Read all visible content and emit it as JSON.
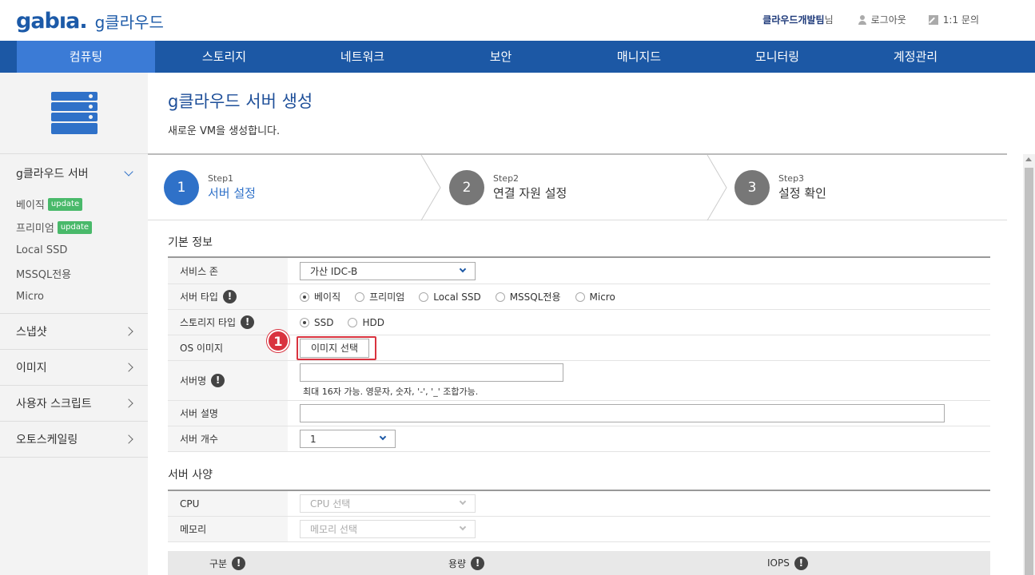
{
  "header": {
    "logo_text": "gabıa.",
    "product_name": "g클라우드",
    "user_name": "클라우드개발팀",
    "user_suffix": "님",
    "logout_label": "로그아웃",
    "inquiry_label": "1:1 문의"
  },
  "nav": {
    "items": [
      "컴퓨팅",
      "스토리지",
      "네트워크",
      "보안",
      "매니지드",
      "모니터링",
      "계정관리"
    ],
    "active_index": 0
  },
  "sidebar": {
    "server_group": {
      "label": "g클라우드 서버",
      "items": [
        {
          "label": "베이직",
          "badge": "update"
        },
        {
          "label": "프리미엄",
          "badge": "update"
        },
        {
          "label": "Local SSD"
        },
        {
          "label": "MSSQL전용"
        },
        {
          "label": "Micro"
        }
      ]
    },
    "groups": [
      "스냅샷",
      "이미지",
      "사용자 스크립트",
      "오토스케일링"
    ]
  },
  "page": {
    "title": "g클라우드 서버 생성",
    "description": "새로운 VM을 생성합니다."
  },
  "steps": [
    {
      "number": "1",
      "small": "Step1",
      "label": "서버 설정",
      "active": true
    },
    {
      "number": "2",
      "small": "Step2",
      "label": "연결 자원 설정",
      "active": false
    },
    {
      "number": "3",
      "small": "Step3",
      "label": "설정 확인",
      "active": false
    }
  ],
  "basic_info": {
    "section_title": "기본 정보",
    "service_zone": {
      "label": "서비스 존",
      "value": "가산 IDC-B"
    },
    "server_type": {
      "label": "서버 타입",
      "options": [
        "베이직",
        "프리미엄",
        "Local SSD",
        "MSSQL전용",
        "Micro"
      ],
      "selected": 0
    },
    "storage_type": {
      "label": "스토리지 타입",
      "options": [
        "SSD",
        "HDD"
      ],
      "selected": 0
    },
    "os_image": {
      "label": "OS 이미지",
      "button": "이미지 선택"
    },
    "server_name": {
      "label": "서버명",
      "value": "",
      "hint": "최대 16자 가능. 영문자, 숫자, '-', '_' 조합가능."
    },
    "server_desc": {
      "label": "서버 설명",
      "value": ""
    },
    "server_count": {
      "label": "서버 개수",
      "value": "1"
    }
  },
  "spec": {
    "section_title": "서버 사양",
    "cpu": {
      "label": "CPU",
      "placeholder": "CPU 선택"
    },
    "memory": {
      "label": "메모리",
      "placeholder": "메모리 선택"
    }
  },
  "disk_table": {
    "headers": [
      "구분",
      "용량",
      "IOPS"
    ]
  },
  "annotation": {
    "marker": "1"
  },
  "colors": {
    "primary": "#1c58a5",
    "active_tab": "#3b7bd6",
    "badge": "#49b96a",
    "highlight": "#d9333f"
  }
}
